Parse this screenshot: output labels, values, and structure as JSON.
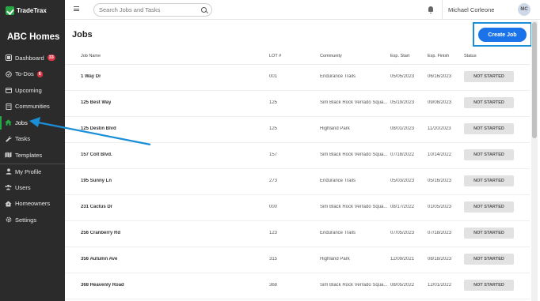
{
  "app": {
    "logo_text": "TradeTrax",
    "company_name": "ABC Homes"
  },
  "sidebar": {
    "items": [
      {
        "label": "Dashboard",
        "icon": "dashboard-icon",
        "badge": "33"
      },
      {
        "label": "To-Dos",
        "icon": "list-icon",
        "badge": "6"
      },
      {
        "label": "Upcoming",
        "icon": "calendar-icon"
      },
      {
        "label": "Communities",
        "icon": "building-icon"
      },
      {
        "label": "Jobs",
        "icon": "home-icon",
        "active": true
      },
      {
        "label": "Tasks",
        "icon": "wrench-icon"
      },
      {
        "label": "Templates",
        "icon": "map-icon"
      },
      {
        "label": "My Profile",
        "icon": "user-icon"
      },
      {
        "label": "Users",
        "icon": "users-icon"
      },
      {
        "label": "Homeowners",
        "icon": "homeowner-icon"
      },
      {
        "label": "Settings",
        "icon": "gear-icon"
      }
    ]
  },
  "topbar": {
    "search_placeholder": "Search Jobs and Tasks",
    "user_name": "Michael Corleone",
    "user_initials": "MC"
  },
  "main": {
    "title": "Jobs",
    "create_button": "Create Job"
  },
  "table": {
    "headers": [
      "Job Name",
      "LOT #",
      "Community",
      "Exp. Start",
      "Exp. Finish",
      "Status"
    ],
    "rows": [
      {
        "name": "1 Way Dr",
        "lot": "001",
        "community": "Endurance Trails",
        "start": "05/05/2023",
        "finish": "06/16/2023",
        "status": "NOT STARTED"
      },
      {
        "name": "125 Best Way",
        "lot": "125",
        "community": "Sim Black Rock Verrado Squa...",
        "start": "05/19/2023",
        "finish": "09/08/2023",
        "status": "NOT STARTED"
      },
      {
        "name": "125 Destin Blvd",
        "lot": "125",
        "community": "Highland Park",
        "start": "08/01/2023",
        "finish": "11/20/2023",
        "status": "NOT STARTED"
      },
      {
        "name": "157 Colt Blvd.",
        "lot": "157",
        "community": "Sim Black Rock Verrado Squa...",
        "start": "07/18/2022",
        "finish": "10/14/2022",
        "status": "NOT STARTED"
      },
      {
        "name": "195 Sunny Ln",
        "lot": "273",
        "community": "Endurance Trails",
        "start": "05/03/2023",
        "finish": "05/16/2023",
        "status": "NOT STARTED"
      },
      {
        "name": "231 Cactus Dr",
        "lot": "000",
        "community": "Sim Black Rock Verrado Squa...",
        "start": "08/17/2022",
        "finish": "01/05/2023",
        "status": "NOT STARTED"
      },
      {
        "name": "256 Cranberry Rd",
        "lot": "123",
        "community": "Endurance Trails",
        "start": "07/05/2023",
        "finish": "07/18/2023",
        "status": "NOT STARTED"
      },
      {
        "name": "356 Autumn Ave",
        "lot": "315",
        "community": "Highland Park",
        "start": "12/09/2021",
        "finish": "08/18/2023",
        "status": "NOT STARTED"
      },
      {
        "name": "368 Heavenly Road",
        "lot": "368",
        "community": "Sim Black Rock Verrado Squa...",
        "start": "08/05/2022",
        "finish": "12/01/2022",
        "status": "NOT STARTED"
      }
    ]
  },
  "colors": {
    "accent_blue": "#1a73e8",
    "highlight_blue": "#1a8fd8",
    "active_green": "#28a745",
    "sidebar_bg": "#2b2b2b",
    "badge_red": "#dc3545"
  }
}
